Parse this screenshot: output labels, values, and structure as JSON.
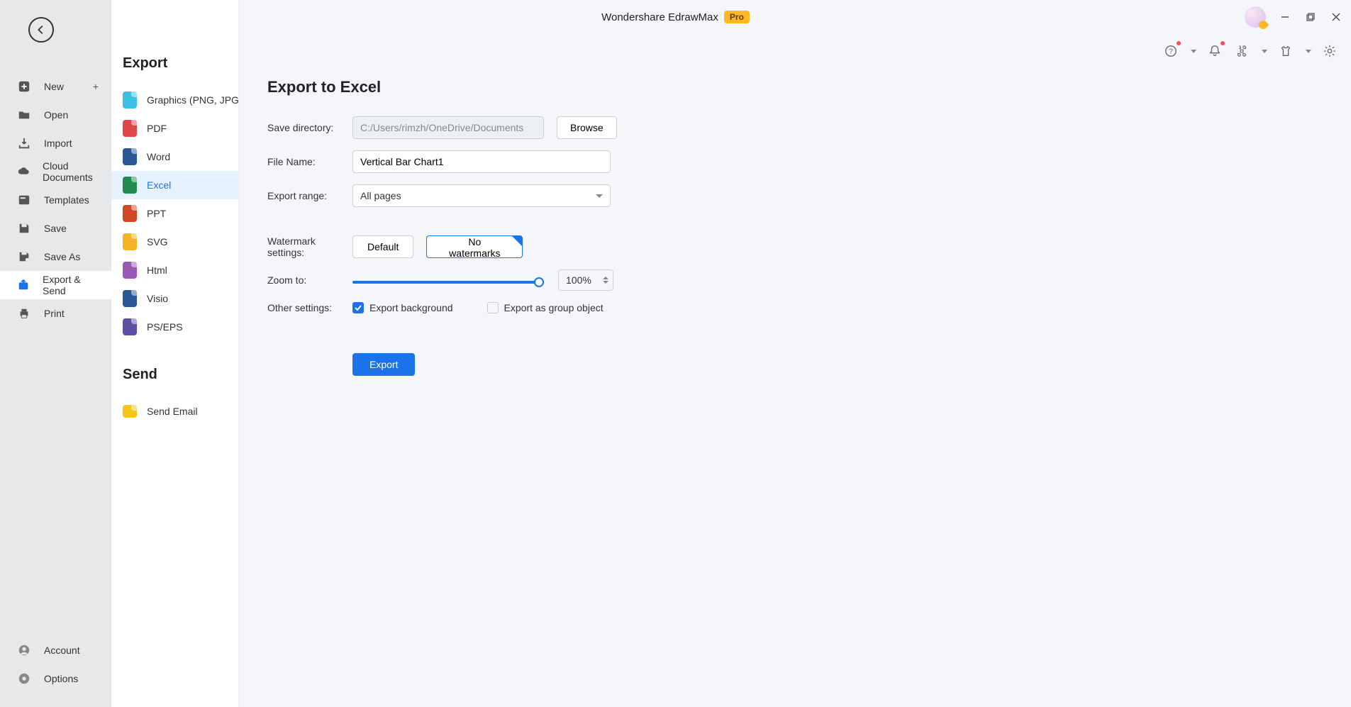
{
  "titlebar": {
    "app_name": "Wondershare EdrawMax",
    "badge": "Pro"
  },
  "left_nav": {
    "items": [
      {
        "icon": "plus-square-icon",
        "label": "New",
        "has_plus": true
      },
      {
        "icon": "folder-icon",
        "label": "Open"
      },
      {
        "icon": "import-icon",
        "label": "Import"
      },
      {
        "icon": "cloud-icon",
        "label": "Cloud Documents"
      },
      {
        "icon": "templates-icon",
        "label": "Templates"
      },
      {
        "icon": "save-icon",
        "label": "Save"
      },
      {
        "icon": "save-as-icon",
        "label": "Save As"
      },
      {
        "icon": "export-send-icon",
        "label": "Export & Send",
        "active": true
      },
      {
        "icon": "print-icon",
        "label": "Print"
      }
    ],
    "bottom": [
      {
        "icon": "account-icon",
        "label": "Account"
      },
      {
        "icon": "gear-icon",
        "label": "Options"
      }
    ]
  },
  "mid_panel": {
    "export_heading": "Export",
    "formats": [
      {
        "label": "Graphics (PNG, JPG et...",
        "color": "#3cc0e6"
      },
      {
        "label": "PDF",
        "color": "#e04848"
      },
      {
        "label": "Word",
        "color": "#2b5797"
      },
      {
        "label": "Excel",
        "color": "#1f8b4c",
        "active": true
      },
      {
        "label": "PPT",
        "color": "#d24726"
      },
      {
        "label": "SVG",
        "color": "#f5b326"
      },
      {
        "label": "Html",
        "color": "#9b59b6"
      },
      {
        "label": "Visio",
        "color": "#2b5797"
      },
      {
        "label": "PS/EPS",
        "color": "#5e4fa2"
      }
    ],
    "send_heading": "Send",
    "send_items": [
      {
        "label": "Send Email",
        "color": "#f5c518"
      }
    ]
  },
  "main": {
    "heading": "Export to Excel",
    "labels": {
      "save_dir": "Save directory:",
      "file_name": "File Name:",
      "export_range": "Export range:",
      "watermark": "Watermark settings:",
      "zoom": "Zoom to:",
      "other": "Other settings:"
    },
    "values": {
      "save_dir": "C:/Users/rimzh/OneDrive/Documents",
      "file_name": "Vertical Bar Chart1",
      "export_range": "All pages",
      "zoom": "100%"
    },
    "buttons": {
      "browse": "Browse",
      "wm_default": "Default",
      "wm_none": "No watermarks",
      "export": "Export"
    },
    "checks": {
      "bg": "Export background",
      "group": "Export as group object"
    }
  }
}
